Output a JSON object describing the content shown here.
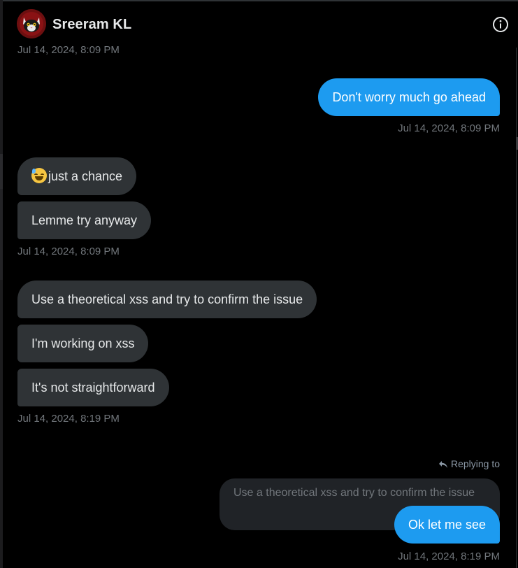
{
  "contact": {
    "name": "Sreeram KL",
    "avatar_icon": "avatar-cat-face"
  },
  "header": {
    "info_icon": "info-circle-icon"
  },
  "colors": {
    "background": "#000000",
    "incoming_bubble": "#2f3336",
    "outgoing_bubble": "#1d9bf0",
    "timestamp": "#71767b",
    "quoted_bubble": "#202327"
  },
  "messages": {
    "top_timestamp": "Jul 14, 2024, 8:09 PM",
    "out1": {
      "text": "Don't worry much go ahead",
      "timestamp": "Jul 14, 2024, 8:09 PM"
    },
    "in_group1": {
      "msg1_emoji": "sweat-smile-emoji",
      "msg1_text": "just a chance",
      "msg2_text": "Lemme try anyway",
      "timestamp": "Jul 14, 2024, 8:09 PM"
    },
    "in_group2": {
      "msg1_text": "Use a theoretical xss and try to confirm the issue",
      "msg2_text": "I'm working on xss",
      "msg3_text": "It's not straightforward",
      "timestamp": "Jul 14, 2024, 8:19 PM"
    },
    "out2": {
      "replying_label": "Replying to",
      "reply_icon": "reply-arrow-icon",
      "quoted_text": "Use a theoretical xss and try to confirm the issue",
      "text": "Ok let me see",
      "timestamp": "Jul 14, 2024, 8:19 PM"
    }
  }
}
